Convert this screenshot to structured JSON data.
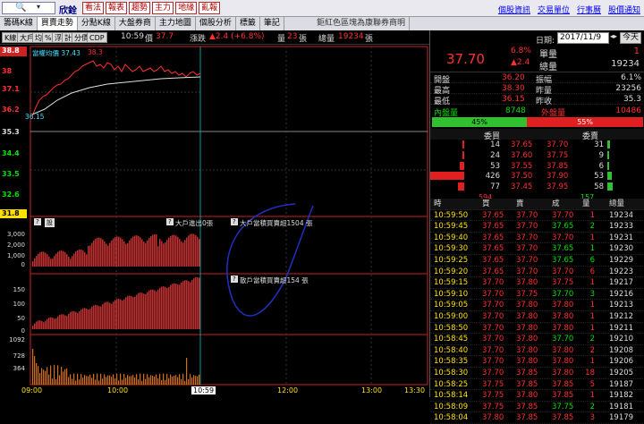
{
  "topbar": {
    "symbol_box": "",
    "stock_name": "欣銓",
    "buttons": [
      "看法",
      "報表",
      "趨勢",
      "主力",
      "地緣",
      "亂報"
    ],
    "links": [
      "個股資訊",
      "交易單位",
      "行事曆",
      "股價通知"
    ]
  },
  "tabs": [
    "籌碼K線",
    "買賣走勢",
    "分點K線",
    "大盤券商",
    "主力地圖",
    "個股分析",
    "標籤",
    "筆記"
  ],
  "active_tab": 1,
  "tab_caption": "鉅紅色區塊為康聯券商明",
  "toolbar": {
    "buttons": [
      "K線",
      "大戶",
      "均",
      "%",
      "浮",
      "計",
      "分價",
      "CDP"
    ],
    "time": "10:59",
    "price_label": "價",
    "price": "37.7",
    "change_label": "漲跌",
    "change": "▲2.4 (+6.8%)",
    "vol_label": "量",
    "vol": "23",
    "vol_unit": "張",
    "total_label": "總量",
    "total": "19234",
    "total_unit": "張"
  },
  "chart": {
    "y_labels_top": [
      "38.8",
      "38",
      "37.1",
      "36.2",
      "35.3",
      "34.4",
      "33.5",
      "32.6",
      "31.8"
    ],
    "caption_avg": "當權均價 37.43",
    "high_label": "38.3",
    "low_label": "36.15",
    "panel2_title": "大戶進出0張",
    "panel2_note": "大戶當積買賣超1504 張",
    "panel2_y": [
      "3,000",
      "2,000",
      "1,000",
      "0"
    ],
    "panel3_note": "散戶當積買賣超154 張",
    "panel3_y": [
      "150",
      "100",
      "50",
      "0"
    ],
    "panel4_y": [
      "1092",
      "728",
      "364"
    ],
    "x_labels": [
      "09:00",
      "10:00",
      "10:59",
      "12:00",
      "13:00",
      "13:30"
    ],
    "q_labels": [
      "?",
      "設"
    ]
  },
  "right": {
    "date_label": "日期:",
    "date": "2017/11/9",
    "today": "今天",
    "price": "37.70",
    "pct": "6.8%",
    "chg": "▲2.4",
    "rows": [
      {
        "l1": "單量",
        "v1": "1"
      },
      {
        "l1": "總量",
        "v1": "19234"
      }
    ],
    "stats": [
      {
        "a": "開盤",
        "av": "36.20",
        "b": "振幅",
        "bv": "6.1%"
      },
      {
        "a": "最高",
        "av": "38.30",
        "b": "昨量",
        "bv": "23256"
      },
      {
        "a": "最低",
        "av": "36.15",
        "b": "昨收",
        "bv": "35.3"
      }
    ],
    "in_label": "內盤量",
    "in_vol": "8748",
    "out_label": "外盤量",
    "out_vol": "10486",
    "in_pct": "45%",
    "out_pct": "55%",
    "buy_title": "委買",
    "sell_title": "委賣",
    "book": [
      {
        "bq": "14",
        "bp": "37.65",
        "ap": "37.70",
        "aq": "31"
      },
      {
        "bq": "24",
        "bp": "37.60",
        "ap": "37.75",
        "aq": "9"
      },
      {
        "bq": "53",
        "bp": "37.55",
        "ap": "37.85",
        "aq": "6"
      },
      {
        "bq": "426",
        "bp": "37.50",
        "ap": "37.90",
        "aq": "53"
      },
      {
        "bq": "77",
        "bp": "37.45",
        "ap": "37.95",
        "aq": "58"
      }
    ],
    "book_sum_bid": "594",
    "book_sum_ask": "157",
    "tick_headers": [
      "時",
      "買",
      "賣",
      "成",
      "量",
      "總量"
    ],
    "ticks": [
      [
        "10:59:50",
        "37.65",
        "37.70",
        "37.70",
        "1",
        "19234"
      ],
      [
        "10:59:45",
        "37.65",
        "37.70",
        "37.65",
        "2",
        "19233"
      ],
      [
        "10:59:40",
        "37.65",
        "37.70",
        "37.70",
        "1",
        "19231"
      ],
      [
        "10:59:30",
        "37.65",
        "37.70",
        "37.65",
        "1",
        "19230"
      ],
      [
        "10:59:25",
        "37.65",
        "37.70",
        "37.65",
        "6",
        "19229"
      ],
      [
        "10:59:20",
        "37.65",
        "37.70",
        "37.70",
        "6",
        "19223"
      ],
      [
        "10:59:15",
        "37.70",
        "37.80",
        "37.75",
        "1",
        "19217"
      ],
      [
        "10:59:10",
        "37.70",
        "37.75",
        "37.70",
        "3",
        "19216"
      ],
      [
        "10:59:05",
        "37.70",
        "37.80",
        "37.80",
        "1",
        "19213"
      ],
      [
        "10:59:00",
        "37.70",
        "37.80",
        "37.80",
        "1",
        "19212"
      ],
      [
        "10:58:50",
        "37.70",
        "37.80",
        "37.80",
        "1",
        "19211"
      ],
      [
        "10:58:45",
        "37.70",
        "37.80",
        "37.70",
        "2",
        "19210"
      ],
      [
        "10:58:40",
        "37.70",
        "37.80",
        "37.80",
        "2",
        "19208"
      ],
      [
        "10:58:35",
        "37.70",
        "37.80",
        "37.80",
        "1",
        "19206"
      ],
      [
        "10:58:30",
        "37.70",
        "37.85",
        "37.80",
        "18",
        "19205"
      ],
      [
        "10:58:25",
        "37.75",
        "37.85",
        "37.85",
        "5",
        "19187"
      ],
      [
        "10:58:14",
        "37.75",
        "37.80",
        "37.85",
        "1",
        "19182"
      ],
      [
        "10:58:09",
        "37.75",
        "37.85",
        "37.75",
        "2",
        "19181"
      ],
      [
        "10:58:04",
        "37.80",
        "37.85",
        "37.85",
        "3",
        "19179"
      ]
    ]
  }
}
